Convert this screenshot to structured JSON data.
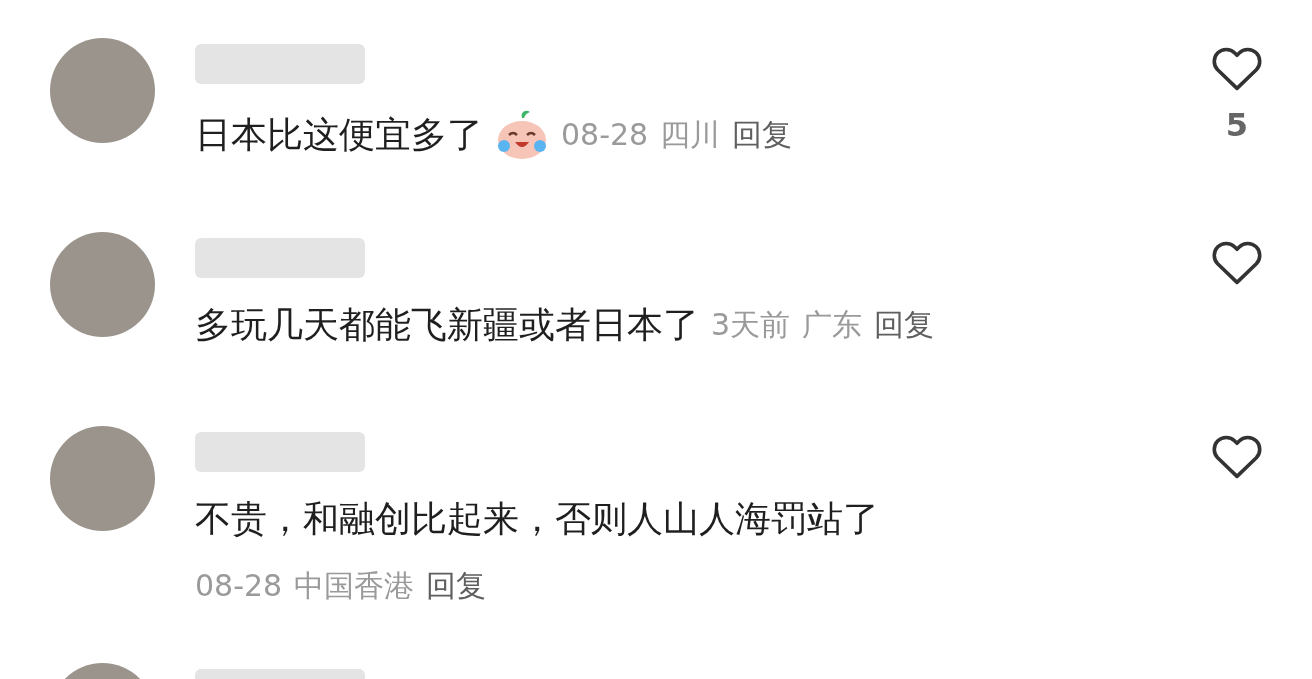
{
  "comments": [
    {
      "kind": "inline",
      "text": "日本比这便宜多了",
      "emoji": true,
      "date": "08-28",
      "location": "四川",
      "reply": "回复",
      "likes": "5"
    },
    {
      "kind": "inline",
      "text": "多玩几天都能飞新疆或者日本了",
      "emoji": false,
      "date": "3天前",
      "location": "广东",
      "reply": "回复"
    },
    {
      "kind": "below",
      "text": "不贵，和融创比起来，否则人山人海罚站了",
      "emoji": false,
      "date": "08-28",
      "location": "中国香港",
      "reply": "回复"
    },
    {
      "kind": "cut"
    }
  ]
}
